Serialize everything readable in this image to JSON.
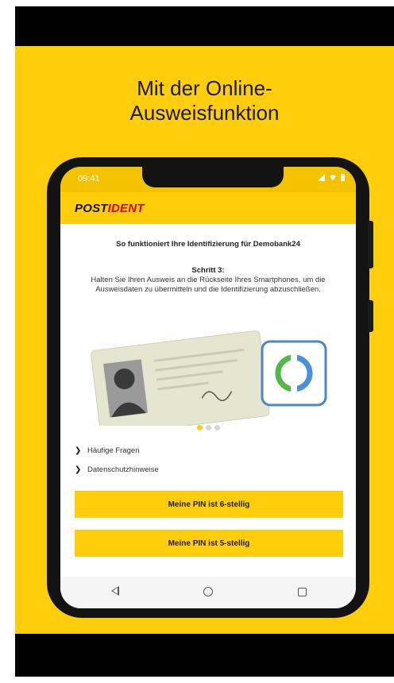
{
  "promo": {
    "headline_line1": "Mit der Online-",
    "headline_line2": "Ausweisfunktion",
    "background_color": "#fecd0b"
  },
  "phone": {
    "status_bar": {
      "time": "09:41",
      "icons": [
        "signal-icon",
        "wifi-icon",
        "battery-icon"
      ]
    },
    "app": {
      "logo_part1": "POST",
      "logo_part2": "IDENT",
      "accent_color": "#fecd0b",
      "brand_red": "#d40511",
      "intro": "So funktioniert Ihre Identifizierung für Demobank24",
      "step_title": "Schritt 3:",
      "step_text": "Halten Sie Ihren Ausweis an die Rückseite Ihres Smartphones, um die Ausweisdaten zu übermitteln und die Identifizierung abzuschließen.",
      "pager": {
        "total": 3,
        "active": 1
      },
      "links": [
        {
          "label": "Häufige Fragen",
          "icon": "chevron-right-icon"
        },
        {
          "label": "Datenschutzhinweise",
          "icon": "chevron-right-icon"
        }
      ],
      "buttons": [
        {
          "label": "Meine PIN ist 6-stellig"
        },
        {
          "label": "Meine PIN ist 5-stellig"
        }
      ]
    },
    "nav_bar": {
      "icons": [
        "back-icon",
        "home-icon",
        "recent-apps-icon"
      ]
    }
  }
}
